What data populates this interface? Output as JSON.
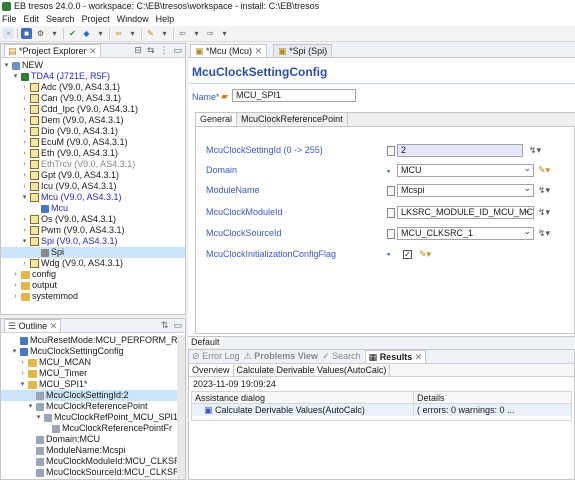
{
  "window": {
    "title": "EB tresos 24.0.0 - workspace: C:\\EB\\tresos\\workspace - install: C:\\EB\\tresos"
  },
  "menu": [
    "File",
    "Edit",
    "Search",
    "Project",
    "Window",
    "Help"
  ],
  "project_explorer": {
    "tab_label": "*Project Explorer",
    "root": "NEW",
    "ecu": "TDA4 (J721E, R5F)",
    "modules": [
      {
        "label": "Adc (V9.0, AS4.3.1)",
        "style": "normal"
      },
      {
        "label": "Can (V9.0, AS4.3.1)",
        "style": "normal"
      },
      {
        "label": "Cdd_Ipc (V9.0, AS4.3.1)",
        "style": "normal"
      },
      {
        "label": "Dem (V9.0, AS4.3.1)",
        "style": "normal"
      },
      {
        "label": "Dio (V9.0, AS4.3.1)",
        "style": "normal"
      },
      {
        "label": "EcuM (V9.0, AS4.3.1)",
        "style": "normal"
      },
      {
        "label": "Eth (V9.0, AS4.3.1)",
        "style": "normal"
      },
      {
        "label": "EthTrcv (V9.0, AS4.3.1)",
        "style": "grey"
      },
      {
        "label": "Gpt (V9.0, AS4.3.1)",
        "style": "normal"
      },
      {
        "label": "Icu (V9.0, AS4.3.1)",
        "style": "normal"
      },
      {
        "label": "Mcu (V9.0, AS4.3.1)",
        "style": "blue"
      },
      {
        "label": "Mcu",
        "style": "child-blue"
      },
      {
        "label": "Os (V9.0, AS4.3.1)",
        "style": "normal"
      },
      {
        "label": "Pwm (V9.0, AS4.3.1)",
        "style": "normal"
      },
      {
        "label": "Spi (V9.0, AS4.3.1)",
        "style": "blue"
      },
      {
        "label": "Spi",
        "style": "child-selected"
      },
      {
        "label": "Wdg (V9.0, AS4.3.1)",
        "style": "normal"
      }
    ],
    "folders": [
      "config",
      "output",
      "systemmod"
    ]
  },
  "outline": {
    "tab_label": "Outline",
    "items": [
      {
        "label": "McuResetMode:MCU_PERFORM_RESI",
        "indent": 1
      },
      {
        "label": "McuClockSettingConfig",
        "indent": 1
      },
      {
        "label": "MCU_MCAN",
        "indent": 2
      },
      {
        "label": "MCU_Timer",
        "indent": 2
      },
      {
        "label": "MCU_SPI1*",
        "indent": 2
      },
      {
        "label": "McuClockSettingId:2",
        "indent": 3,
        "selected": true
      },
      {
        "label": "McuClockReferencePoint",
        "indent": 3
      },
      {
        "label": "McuClockRefPoint_MCU_SPI1",
        "indent": 4
      },
      {
        "label": "McuClockReferencePointFr",
        "indent": 5
      },
      {
        "label": "Domain:MCU",
        "indent": 3
      },
      {
        "label": "ModuleName:Mcspi",
        "indent": 3
      },
      {
        "label": "McuClockModuleId:MCU_CLKSR",
        "indent": 3
      },
      {
        "label": "McuClockSourceId:MCU_CLKSR",
        "indent": 3
      }
    ]
  },
  "editor": {
    "tabs": [
      "*Mcu (Mcu)",
      "*Spi (Spi)"
    ],
    "heading": "McuClockSettingConfig",
    "name_label": "Name*",
    "name_value": "MCU_SPI1",
    "subtabs": [
      "General",
      "McuClockReferencePoint"
    ],
    "fields": [
      {
        "label": "McuClockSettingId (0 -> 255)",
        "value": "2"
      },
      {
        "label": "Domain",
        "value": "MCU"
      },
      {
        "label": "ModuleName",
        "value": "Mcspi"
      },
      {
        "label": "McuClockModuleId",
        "value": "LKSRC_MODULE_ID_MCU_MCSPI1"
      },
      {
        "label": "McuClockSourceId",
        "value": "MCU_CLKSRC_1"
      },
      {
        "label": "McuClockInitializationConfigFlag",
        "value": "✓"
      }
    ],
    "bottom_tab": "Default"
  },
  "results": {
    "tabs": [
      "Error Log",
      "Problems View",
      "Search",
      "Results"
    ],
    "subtabs": [
      "Overview",
      "Calculate Derivable Values(AutoCalc)"
    ],
    "timestamp": "2023-11-09 19:09:24",
    "columns": [
      "Assistance dialog",
      "Details"
    ],
    "rows": [
      {
        "dialog": "Calculate Derivable Values(AutoCalc)",
        "details": "( errors: 0 warnings: 0 ..."
      }
    ]
  }
}
